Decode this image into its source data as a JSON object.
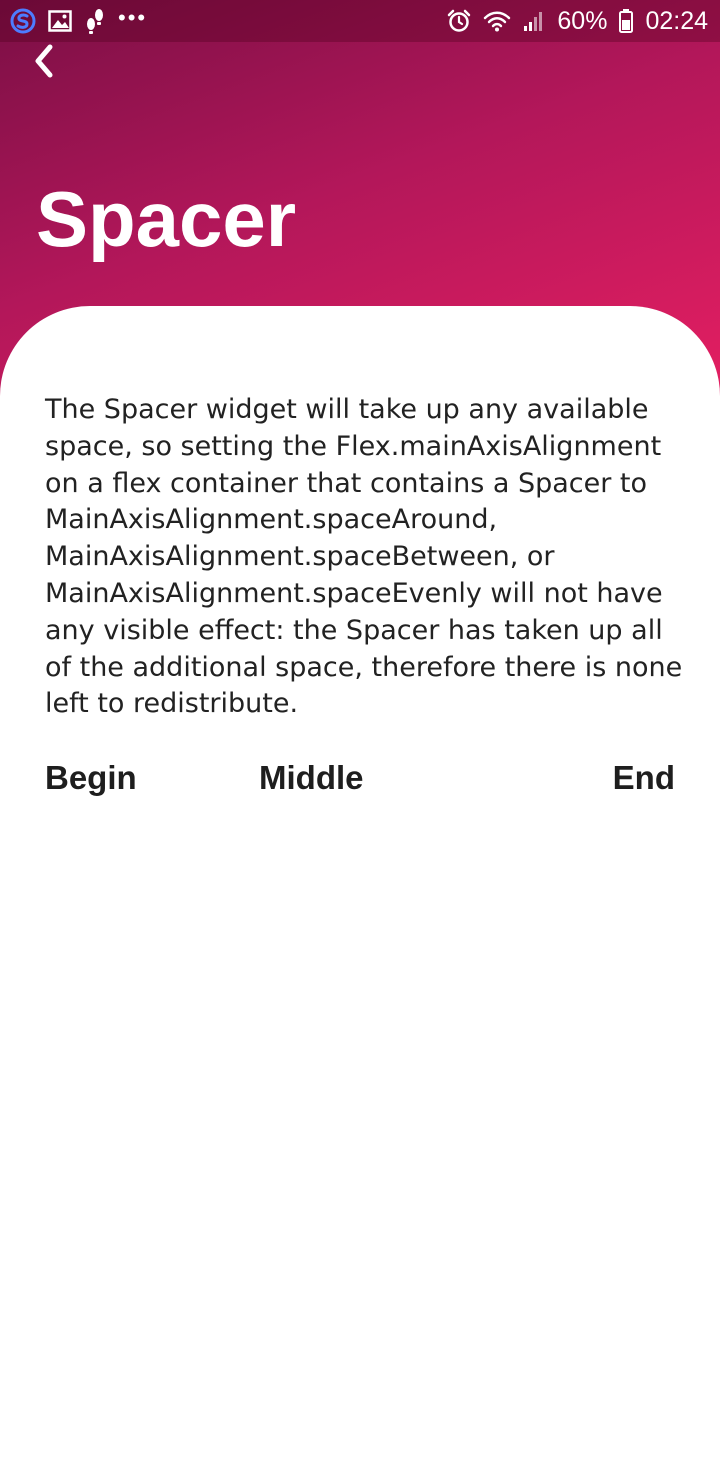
{
  "status_bar": {
    "icons_left": [
      "app-s-icon",
      "gallery-icon",
      "footprints-icon",
      "more-dots-icon"
    ],
    "more_dots": "•••",
    "icons_right": [
      "alarm-icon",
      "wifi-icon",
      "signal-icon",
      "battery-icon"
    ],
    "battery_percent": "60%",
    "time": "02:24"
  },
  "header": {
    "back_icon": "chevron-left-icon",
    "title": "Spacer",
    "gradient_colors": [
      "#7a0f45",
      "#b3175a",
      "#e81f62"
    ]
  },
  "content": {
    "description": "The Spacer widget will take up any available space, so setting the Flex.mainAxisAlignment on a flex container that contains a Spacer to MainAxisAlignment.spaceAround, MainAxisAlignment.spaceBetween, or MainAxisAlignment.spaceEvenly will not have any visible effect: the Spacer has taken up all of the additional space, therefore there is none left to redistribute.",
    "example_row": {
      "begin": "Begin",
      "middle": "Middle",
      "end": "End"
    }
  }
}
